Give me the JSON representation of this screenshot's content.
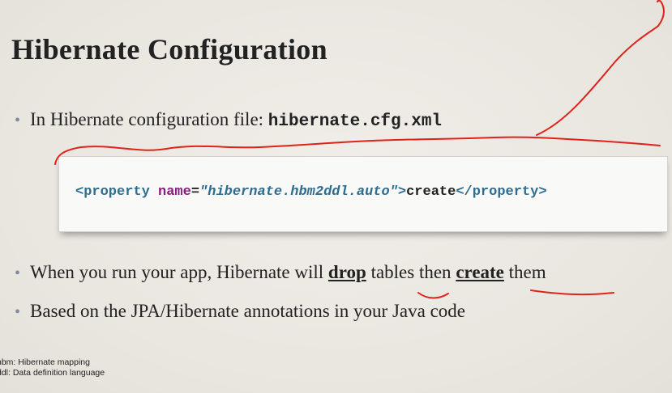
{
  "slide": {
    "title": "Hibernate Configuration",
    "bullet1": {
      "text": "In Hibernate configuration file: ",
      "code": "hibernate.cfg.xml"
    },
    "code": {
      "open_tag": "<property",
      "attr_name": "name",
      "equals": "=",
      "attr_value": "\"hibernate.hbm2ddl.auto\"",
      "close_bracket": ">",
      "content": "create",
      "end_tag": "</property>"
    },
    "bullet2": {
      "part1": "When you run your app, Hibernate will ",
      "drop": "drop",
      "part2": " tables then ",
      "create": "create",
      "part3": " them"
    },
    "bullet3": {
      "text": "Based on the JPA/Hibernate annotations in your Java code"
    },
    "footnotes": [
      "hbm: Hibernate mapping",
      "ddl: Data definition language"
    ]
  },
  "colors": {
    "annotation_ink": "#e0231a",
    "code_tag": "#2f6c8f",
    "code_attr": "#8b1d7c",
    "bullet_dot": "#7d8ba1"
  }
}
